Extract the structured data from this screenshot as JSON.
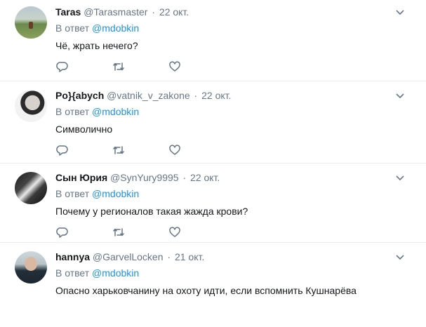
{
  "tweets": [
    {
      "name": "Taras",
      "handle": "@Tarasmaster",
      "dot": "·",
      "date": "22 окт.",
      "reply_prefix": "В ответ",
      "reply_mention": "@mdobkin",
      "text": "Чё, жрать нечего?"
    },
    {
      "name": "Po}{abych",
      "handle": "@vatnik_v_zakone",
      "dot": "·",
      "date": "22 окт.",
      "reply_prefix": "В ответ",
      "reply_mention": "@mdobkin",
      "text": "Символично"
    },
    {
      "name": "Сын Юрия",
      "handle": "@SynYury9995",
      "dot": "·",
      "date": "22 окт.",
      "reply_prefix": "В ответ",
      "reply_mention": "@mdobkin",
      "text": "Почему у регионалов такая жажда крови?"
    },
    {
      "name": "hannya",
      "handle": "@GarvelLocken",
      "dot": "·",
      "date": "21 окт.",
      "reply_prefix": "В ответ",
      "reply_mention": "@mdobkin",
      "text": "Опасно харьковчанину на охоту идти, если вспомнить Кушнарёва"
    }
  ],
  "icons": {
    "reply": "reply-icon",
    "retweet": "retweet-icon",
    "like": "heart-icon",
    "menu": "chevron-down-icon"
  },
  "colors": {
    "name": "#14171a",
    "secondary": "#657786",
    "mention": "#1b95e0",
    "divider": "#e6ecf0"
  }
}
